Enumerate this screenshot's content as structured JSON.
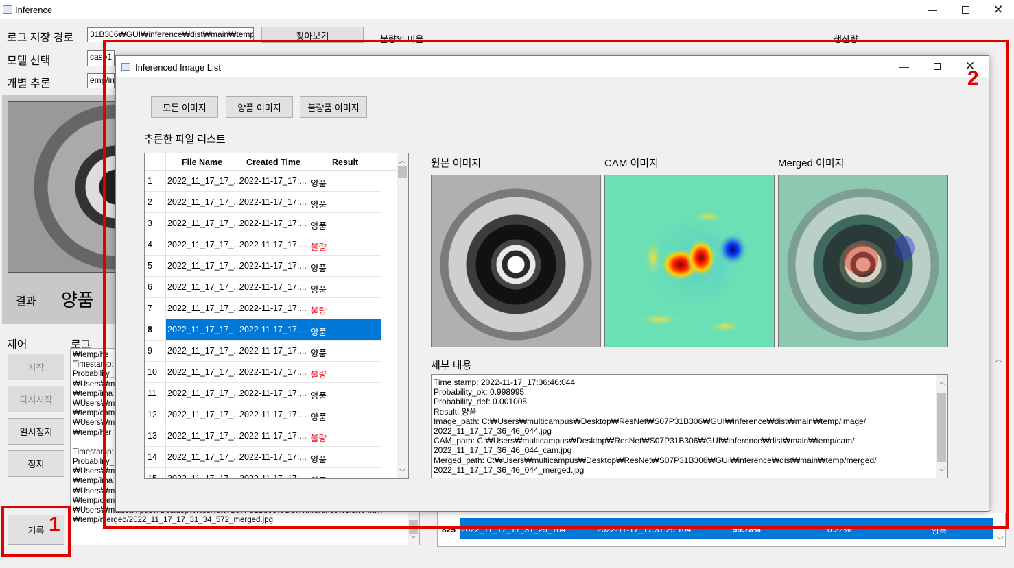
{
  "main_window": {
    "title": "Inference",
    "log_path_label": "로그 저장 경로",
    "log_path_value": "31B306₩GUI₩inference₩dist₩main₩temp",
    "browse_button": "찾아보기",
    "model_label": "모델 선택",
    "model_value": "case1",
    "single_label": "개별 추론",
    "single_value": "emp/im",
    "defect_ratio_label": "불량의 비율",
    "production_label": "생산량",
    "result_label": "결과",
    "result_value": "양품",
    "control_label": "제어",
    "log_label": "로그",
    "start_button": "시작",
    "restart_button": "다시시작",
    "pause_button": "일시정지",
    "stop_button": "정지",
    "record_button": "기록",
    "log_lines": [
      "₩temp/he",
      "Timestamp:",
      "Probability_",
      "₩Users₩m",
      "₩temp/ima",
      "₩Users₩m",
      "₩temp/cam",
      "₩Users₩m",
      "₩temp/her",
      "",
      "Timestamp:",
      "Probability_",
      "₩Users₩m",
      "₩temp/ima",
      "₩Users₩m",
      "₩temp/cam",
      "₩Users₩multicampus₩Desktop₩ResNet₩S07P31B306₩GUI₩inference₩dist₩main",
      "₩temp/merged/2022_11_17_17_31_34_572_merged.jpg"
    ],
    "bottom_row": {
      "index": "825",
      "name": "2022_11_17_17_31_29_104",
      "time": "2022-11-17_17:31:29:104",
      "ok": "99.78%",
      "def": "0.22%",
      "result": "양품"
    }
  },
  "dialog": {
    "title": "Inferenced Image List",
    "filter_all": "모든 이미지",
    "filter_ok": "양품 이미지",
    "filter_bad": "불량품 이미지",
    "list_title": "추론한 파일 리스트",
    "columns": [
      "File Name",
      "Created Time",
      "Result"
    ],
    "rows": [
      {
        "n": "1",
        "name": "2022_11_17_17_...",
        "time": "2022-11-17_17:...",
        "result": "양품",
        "bad": false
      },
      {
        "n": "2",
        "name": "2022_11_17_17_...",
        "time": "2022-11-17_17:...",
        "result": "양품",
        "bad": false
      },
      {
        "n": "3",
        "name": "2022_11_17_17_...",
        "time": "2022-11-17_17:...",
        "result": "양품",
        "bad": false
      },
      {
        "n": "4",
        "name": "2022_11_17_17_...",
        "time": "2022-11-17_17:...",
        "result": "불량",
        "bad": true
      },
      {
        "n": "5",
        "name": "2022_11_17_17_...",
        "time": "2022-11-17_17:...",
        "result": "양품",
        "bad": false
      },
      {
        "n": "6",
        "name": "2022_11_17_17_...",
        "time": "2022-11-17_17:...",
        "result": "양품",
        "bad": false
      },
      {
        "n": "7",
        "name": "2022_11_17_17_...",
        "time": "2022-11-17_17:...",
        "result": "불량",
        "bad": true
      },
      {
        "n": "8",
        "name": "2022_11_17_17_...",
        "time": "2022-11-17_17:...",
        "result": "양품",
        "bad": false,
        "selected": true
      },
      {
        "n": "9",
        "name": "2022_11_17_17_...",
        "time": "2022-11-17_17:...",
        "result": "양품",
        "bad": false
      },
      {
        "n": "10",
        "name": "2022_11_17_17_...",
        "time": "2022-11-17_17:...",
        "result": "불량",
        "bad": true
      },
      {
        "n": "11",
        "name": "2022_11_17_17_...",
        "time": "2022-11-17_17:...",
        "result": "양품",
        "bad": false
      },
      {
        "n": "12",
        "name": "2022_11_17_17_...",
        "time": "2022-11-17_17:...",
        "result": "양품",
        "bad": false
      },
      {
        "n": "13",
        "name": "2022_11_17_17_...",
        "time": "2022-11-17_17:...",
        "result": "불량",
        "bad": true
      },
      {
        "n": "14",
        "name": "2022_11_17_17_...",
        "time": "2022-11-17_17:...",
        "result": "양품",
        "bad": false
      },
      {
        "n": "15",
        "name": "2022_11_17_17_",
        "time": "2022-11-17_17:",
        "result": "양품",
        "bad": false
      }
    ],
    "original_label": "원본 이미지",
    "cam_label": "CAM 이미지",
    "merged_label": "Merged 이미지",
    "detail_label": "세부 내용",
    "details": [
      "Time stamp: 2022-11-17_17:36:46:044",
      "Probability_ok: 0.998995",
      "Probability_def: 0.001005",
      "Result: 양품",
      "Image_path: C:₩Users₩multicampus₩Desktop₩ResNet₩S07P31B306₩GUI₩inference₩dist₩main₩temp/image/",
      "2022_11_17_17_36_46_044.jpg",
      "CAM_path: C:₩Users₩multicampus₩Desktop₩ResNet₩S07P31B306₩GUI₩inference₩dist₩main₩temp/cam/",
      "2022_11_17_17_36_46_044_cam.jpg",
      "Merged_path: C:₩Users₩multicampus₩Desktop₩ResNet₩S07P31B306₩GUI₩inference₩dist₩main₩temp/merged/",
      "2022_11_17_17_36_46_044_merged.jpg"
    ]
  },
  "annotations": {
    "marker1": "1",
    "marker2": "2"
  }
}
